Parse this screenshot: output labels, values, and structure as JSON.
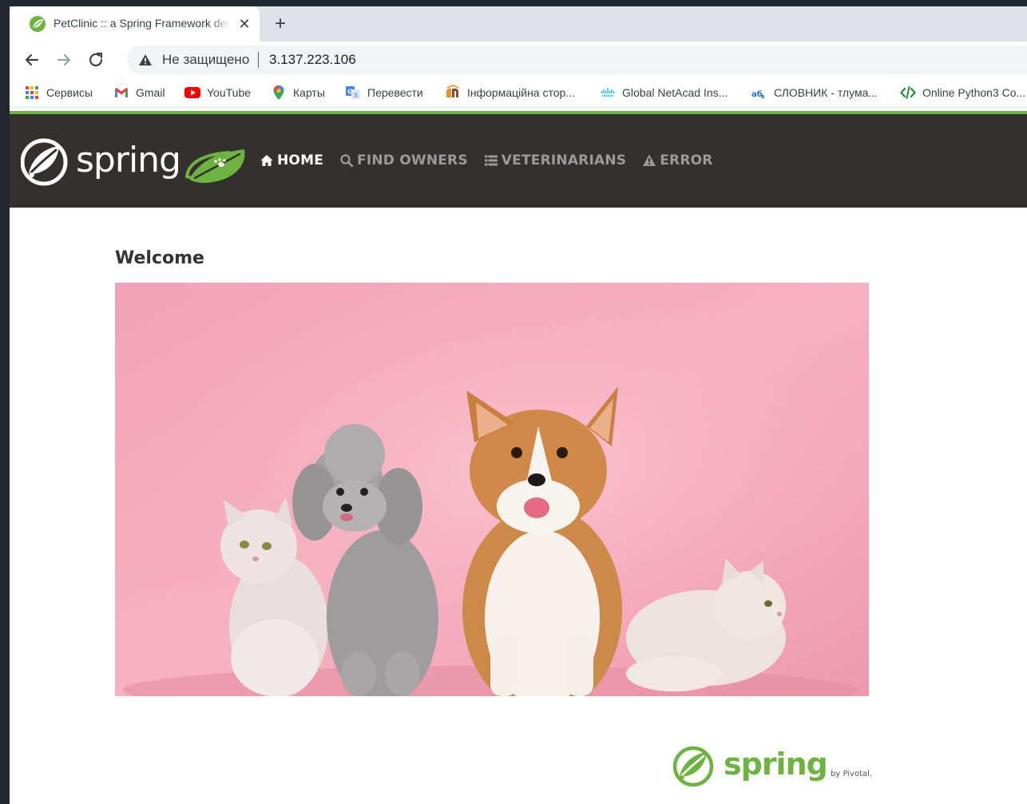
{
  "browser": {
    "tab": {
      "title": "PetClinic :: a Spring Framework demonstration",
      "close_glyph": "✕"
    },
    "new_tab_glyph": "+",
    "address": {
      "security_label": "Не защищено",
      "url": "3.137.223.106"
    },
    "bookmarks": [
      {
        "label": "Сервисы",
        "icon": "apps-grid-icon"
      },
      {
        "label": "Gmail",
        "icon": "gmail-icon"
      },
      {
        "label": "YouTube",
        "icon": "youtube-icon"
      },
      {
        "label": "Карты",
        "icon": "maps-pin-icon"
      },
      {
        "label": "Перевести",
        "icon": "translate-icon"
      },
      {
        "label": "Інформаційна стор...",
        "icon": "info-page-icon"
      },
      {
        "label": "Global NetAcad Ins...",
        "icon": "cisco-icon"
      },
      {
        "label": "СЛОВНИК - тлума...",
        "icon": "dictionary-icon"
      },
      {
        "label": "Online Python3 Co...",
        "icon": "code-icon"
      }
    ]
  },
  "site": {
    "brand_text": "spring",
    "menu": [
      {
        "label": "HOME",
        "icon": "home-icon",
        "active": true
      },
      {
        "label": "FIND OWNERS",
        "icon": "search-icon",
        "active": false
      },
      {
        "label": "VETERINARIANS",
        "icon": "list-icon",
        "active": false
      },
      {
        "label": "ERROR",
        "icon": "warning-icon",
        "active": false
      }
    ],
    "heading": "Welcome",
    "footer": {
      "brand_text": "spring",
      "by_text": "by Pivotal."
    }
  },
  "colors": {
    "spring_green": "#6db33f",
    "navbar_bg": "#34302d",
    "hero_pink": "#f2a7b8"
  }
}
